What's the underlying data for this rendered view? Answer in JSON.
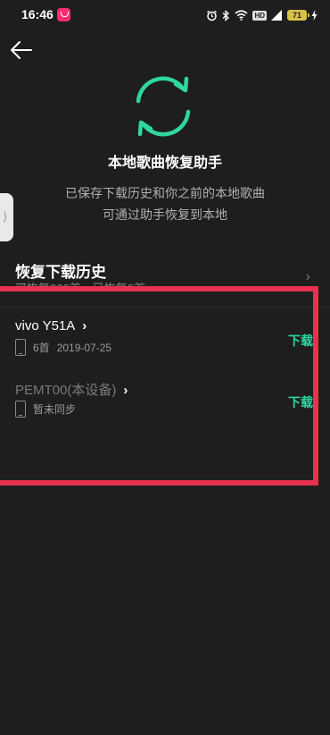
{
  "status_bar": {
    "time": "16:46",
    "battery": "71",
    "hd_label": "HD"
  },
  "hero": {
    "title": "本地歌曲恢复助手",
    "desc_line1": "已保存下载历史和你之前的本地歌曲",
    "desc_line2": "可通过助手恢复到本地"
  },
  "section": {
    "title": "恢复下载历史",
    "subtitle": "可恢复000首，已恢复0首",
    "chevron": "›"
  },
  "devices": [
    {
      "name": "vivo Y51A",
      "chevron": "›",
      "count": "6首",
      "date": "2019-07-25",
      "action": "下载"
    },
    {
      "name": "PEMT00(本设备)",
      "chevron": "›",
      "status": "暂未同步",
      "action": "下载"
    }
  ],
  "colors": {
    "accent": "#2fd7a0",
    "annotation": "#e8304f",
    "background": "#1e1e1e"
  },
  "icons": {
    "back": "back-arrow-icon",
    "refresh": "refresh-icon",
    "device": "phone-icon"
  }
}
